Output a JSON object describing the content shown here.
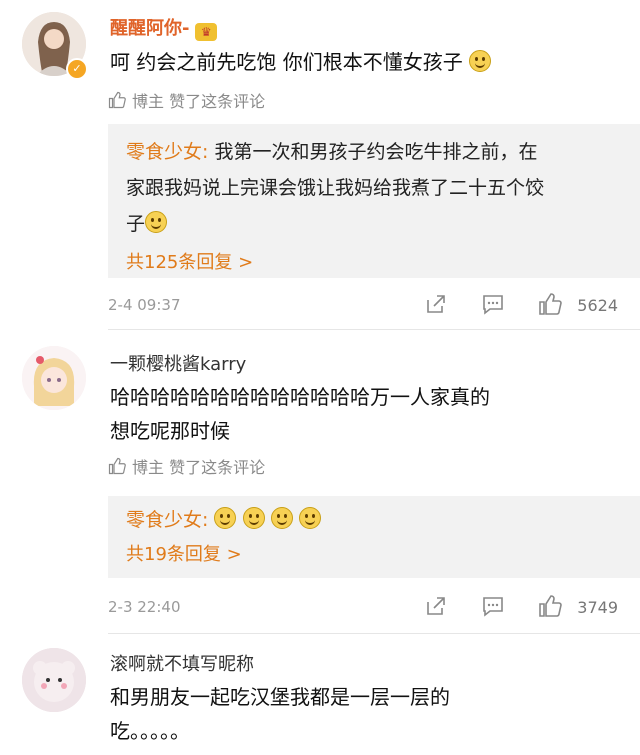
{
  "comments": [
    {
      "name": "醒醒阿你-",
      "name_color": "#e0642a",
      "text": "呵 约会之前先吃饱 你们根本不懂女孩子",
      "liked_label": "博主 赞了这条评论",
      "reply": {
        "author": "零食少女:",
        "text1": " 我第一次和男孩子约会吃牛排之前，在",
        "text2": "家跟我妈说上完课会饿让我妈给我煮了二十五个饺",
        "text3": "子",
        "more": "共125条回复 >"
      },
      "time": "2-4 09:37",
      "likes": "5624"
    },
    {
      "name": "一颗樱桃酱karry",
      "name_color": "#333333",
      "text1": "哈哈哈哈哈哈哈哈哈哈哈哈哈万一人家真的",
      "text2": "想吃呢那时候",
      "liked_label": "博主 赞了这条评论",
      "reply": {
        "author": "零食少女:",
        "more": "共19条回复 >"
      },
      "time": "2-3 22:40",
      "likes": "3749"
    },
    {
      "name": "滚啊就不填写昵称",
      "name_color": "#333333",
      "text1": "和男朋友一起吃汉堡我都是一层一层的",
      "text2": "吃。。。。。"
    }
  ],
  "icons": {
    "share": "share-icon",
    "comment": "comment-icon",
    "like": "thumbs-up-icon",
    "crown": "crown-icon",
    "verified": "verified-badge-icon"
  }
}
